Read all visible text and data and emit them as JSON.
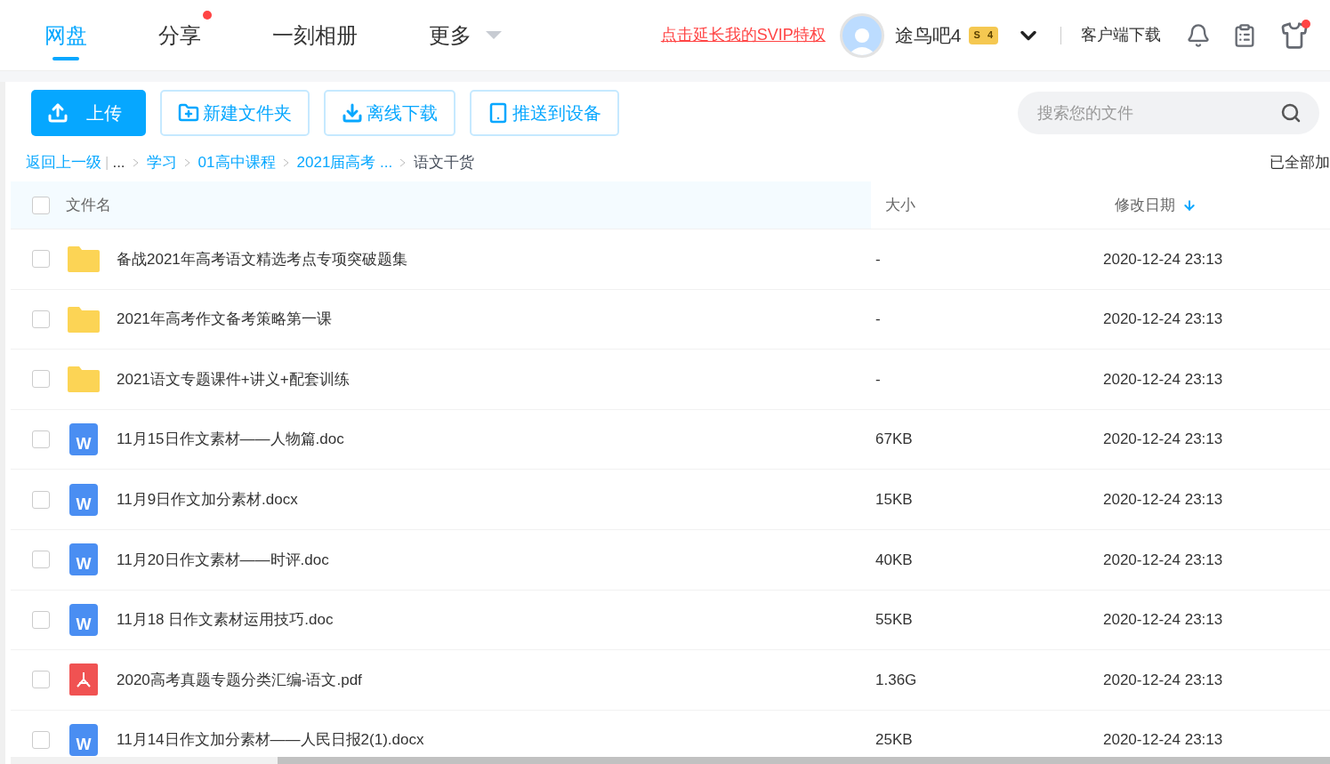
{
  "nav": {
    "tabs": [
      {
        "label": "网盘",
        "selected": true,
        "dot": false,
        "caret": false
      },
      {
        "label": "分享",
        "selected": false,
        "dot": true,
        "caret": false
      },
      {
        "label": "一刻相册",
        "selected": false,
        "dot": false,
        "caret": false
      },
      {
        "label": "更多",
        "selected": false,
        "dot": false,
        "caret": true
      }
    ],
    "promo_link": "点击延长我的SVIP特权",
    "username": "途鸟吧4",
    "vip_badge": {
      "letter": "S",
      "level": "4"
    },
    "client_download": "客户端下载",
    "shirt_dot": true
  },
  "toolbar": {
    "buttons": [
      {
        "label": "上传",
        "kind": "upload"
      },
      {
        "label": "新建文件夹",
        "kind": "new-folder"
      },
      {
        "label": "离线下载",
        "kind": "download"
      },
      {
        "label": "推送到设备",
        "kind": "device"
      }
    ],
    "search": {
      "placeholder": "搜索您的文件"
    }
  },
  "breadcrumb": {
    "back": "返回上一级",
    "separator": "|",
    "items": [
      "...",
      "学习",
      "01高中课程",
      "2021届高考 ..."
    ],
    "current": "语文干货",
    "status": "已全部加"
  },
  "table": {
    "columns": [
      "文件名",
      "大小",
      "修改日期"
    ],
    "select_all_checked": false,
    "rows": [
      {
        "kind": "folder",
        "name": "备战2021年高考语文精选考点专项突破题集",
        "size": "-",
        "date": "2020-12-24 23:13",
        "checked": false
      },
      {
        "kind": "folder",
        "name": "2021年高考作文备考策略第一课",
        "size": "-",
        "date": "2020-12-24 23:13",
        "checked": false
      },
      {
        "kind": "folder",
        "name": "2021语文专题课件+讲义+配套训练",
        "size": "-",
        "date": "2020-12-24 23:13",
        "checked": false
      },
      {
        "kind": "word",
        "icon_text": "W",
        "name": "11月15日作文素材——人物篇.doc",
        "size": "67KB",
        "date": "2020-12-24 23:13",
        "checked": false
      },
      {
        "kind": "word",
        "icon_text": "W",
        "name": "11月9日作文加分素材.docx",
        "size": "15KB",
        "date": "2020-12-24 23:13",
        "checked": false
      },
      {
        "kind": "word",
        "icon_text": "W",
        "name": "11月20日作文素材——时评.doc",
        "size": "40KB",
        "date": "2020-12-24 23:13",
        "checked": false
      },
      {
        "kind": "word",
        "icon_text": "W",
        "name": "11月18 日作文素材运用技巧.doc",
        "size": "55KB",
        "date": "2020-12-24 23:13",
        "checked": false
      },
      {
        "kind": "pdf",
        "name": "2020高考真题专题分类汇编-语文.pdf",
        "size": "1.36G",
        "date": "2020-12-24 23:13",
        "checked": false
      },
      {
        "kind": "word",
        "icon_text": "W",
        "name": "11月14日作文加分素材——人民日报2(1).docx",
        "size": "25KB",
        "date": "2020-12-24 23:13",
        "checked": false
      }
    ]
  }
}
